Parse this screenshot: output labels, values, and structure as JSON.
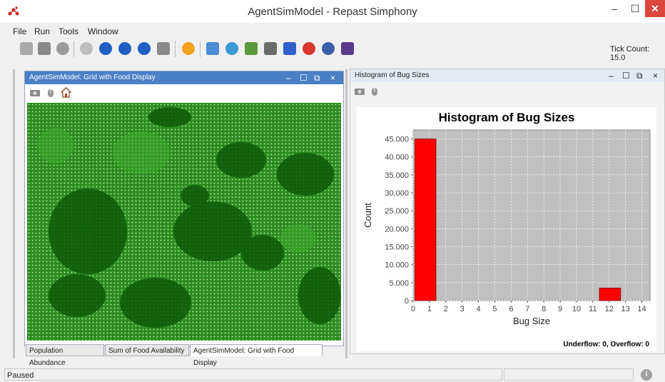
{
  "window": {
    "title": "AgentSimModel - Repast Simphony",
    "minimize_glyph": "–",
    "maximize_glyph": "☐",
    "close_glyph": "✕"
  },
  "menu": [
    "File",
    "Run",
    "Tools",
    "Window"
  ],
  "toolbar": {
    "tick_count": "Tick Count: 15.0",
    "icons": [
      "load-model-icon",
      "save-model-icon",
      "database-icon",
      "power-icon",
      "start-run-icon",
      "step-run-icon",
      "stop-run-icon",
      "reset-run-icon",
      "batch-run-icon",
      "zoom-icon",
      "agent-browser-icon",
      "image-export-icon",
      "settings-icon",
      "chart-icon",
      "pie-chart-icon",
      "server-icon",
      "cluster-icon"
    ]
  },
  "left_panel": {
    "title": "AgentSimModel: Grid with Food Display",
    "controls": {
      "min": "–",
      "max": "☐",
      "restore": "⧉",
      "close": "×"
    }
  },
  "right_panel": {
    "title": "Histogram of Bug Sizes",
    "controls": {
      "min": "–",
      "max": "☐",
      "restore": "⧉",
      "close": "×"
    }
  },
  "chart_data": {
    "type": "bar",
    "title": "Histogram of Bug Sizes",
    "xlabel": "Bug Size",
    "ylabel": "Count",
    "xlim": [
      0,
      14.5
    ],
    "ylim": [
      0,
      47500
    ],
    "xticks": [
      "0",
      "1",
      "2",
      "3",
      "4",
      "5",
      "6",
      "7",
      "8",
      "9",
      "10",
      "11",
      "12",
      "13",
      "14"
    ],
    "yticks": [
      "0",
      "5.000",
      "10.000",
      "15.000",
      "20.000",
      "25.000",
      "30.000",
      "35.000",
      "40.000",
      "45.000"
    ],
    "bins": [
      {
        "x0": 0.1,
        "x1": 1.4,
        "value": 45000
      },
      {
        "x0": 11.4,
        "x1": 12.7,
        "value": 3500
      }
    ],
    "bar_color": "#ff0000",
    "plot_bg": "#c0c0c0",
    "grid": true,
    "footer": "Underflow: 0, Overflow: 0"
  },
  "bottom_tabs": [
    "Population Abundance",
    "Sum of Food Availability",
    "AgentSimModel: Grid with Food Display"
  ],
  "status": {
    "text": "Paused",
    "info_glyph": "i"
  },
  "colors": {
    "grid_green": "#2b8e1f",
    "dark_green": "#0d5a07",
    "active_title": "#4a80c6"
  }
}
